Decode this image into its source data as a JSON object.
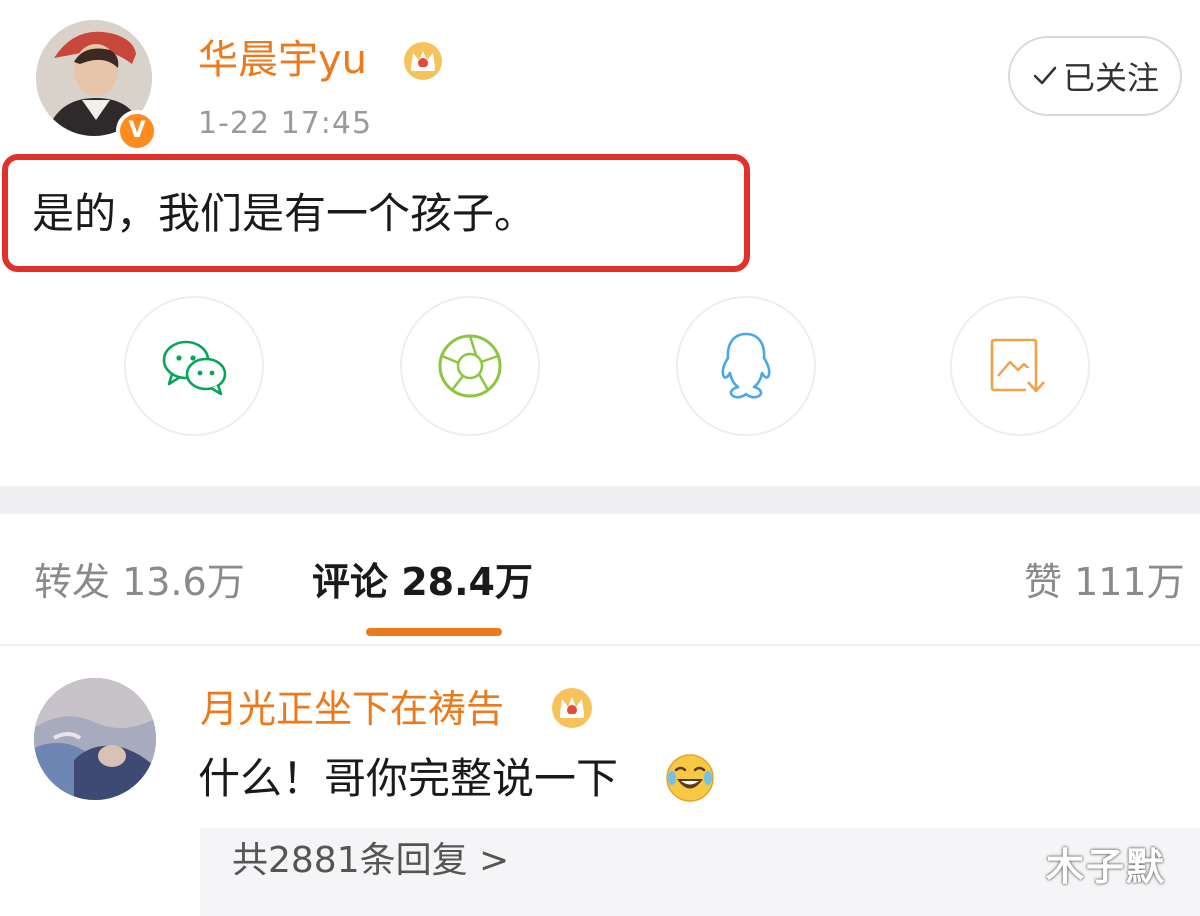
{
  "post": {
    "author_name": "华晨宇yu",
    "timestamp": "1-22 17:45",
    "follow_label": "已关注",
    "content": "是的，我们是有一个孩子。"
  },
  "share": {
    "icons": [
      "wechat-icon",
      "moments-icon",
      "qq-icon",
      "save-image-icon"
    ]
  },
  "tabs": {
    "repost": "转发 13.6万",
    "comment": "评论 28.4万",
    "like": "赞 111万"
  },
  "comment": {
    "author": "月光正坐下在祷告",
    "text": "什么！哥你完整说一下",
    "replies_link": "共2881条回复 >"
  },
  "watermark": "木子默",
  "colors": {
    "accent_orange": "#ec7a1c",
    "highlight_red": "#e3312a",
    "wechat_green": "#07c160",
    "qq_blue": "#4aa8e8"
  }
}
